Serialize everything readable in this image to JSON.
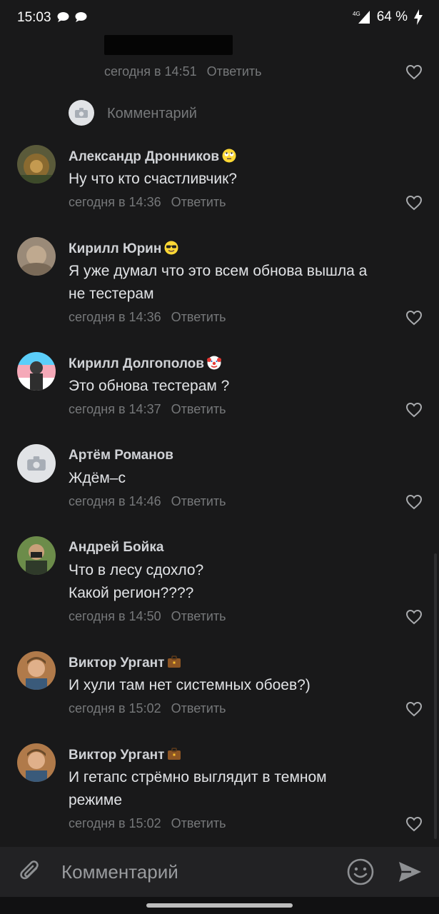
{
  "status_bar": {
    "time": "15:03",
    "network": "4G",
    "battery": "64 %"
  },
  "top_reply": {
    "meta_time": "сегодня в 14:51",
    "reply_label": "Ответить"
  },
  "sub_comment_input": {
    "placeholder": "Комментарий"
  },
  "comments": [
    {
      "author": "Александр Дронников",
      "emoji": "rolling-eyes-emoji",
      "text_lines": [
        "Ну что кто счастливчик?"
      ],
      "time": "сегодня в 14:36",
      "reply_label": "Ответить"
    },
    {
      "author": "Кирилл Юрин",
      "emoji": "sunglasses-emoji",
      "text_lines": [
        "Я уже думал что это всем обнова вышла а",
        "не тестерам"
      ],
      "time": "сегодня в 14:36",
      "reply_label": "Ответить"
    },
    {
      "author": "Кирилл Долгополов",
      "emoji": "clown-emoji",
      "text_lines": [
        "Это обнова тестерам ?"
      ],
      "time": "сегодня в 14:37",
      "reply_label": "Ответить"
    },
    {
      "author": "Артём Романов",
      "emoji": "",
      "text_lines": [
        "Ждём–с"
      ],
      "time": "сегодня в 14:46",
      "reply_label": "Ответить"
    },
    {
      "author": "Андрей Бойка",
      "emoji": "",
      "text_lines": [
        "Что в лесу сдохло?",
        "Какой регион????"
      ],
      "time": "сегодня в 14:50",
      "reply_label": "Ответить"
    },
    {
      "author": "Виктор Ургант",
      "emoji": "briefcase-emoji",
      "text_lines": [
        "И хули там нет системных обоев?)"
      ],
      "time": "сегодня в 15:02",
      "reply_label": "Ответить"
    },
    {
      "author": "Виктор Ургант",
      "emoji": "briefcase-emoji",
      "text_lines": [
        "И гетапс стрёмно выглядит в темном",
        "режиме"
      ],
      "time": "сегодня в 15:02",
      "reply_label": "Ответить"
    }
  ],
  "bottom_input": {
    "placeholder": "Комментарий"
  },
  "colors": {
    "background": "#19191a",
    "text": "#e1e3e6",
    "secondary": "#76787a",
    "input_bar": "#222224"
  }
}
